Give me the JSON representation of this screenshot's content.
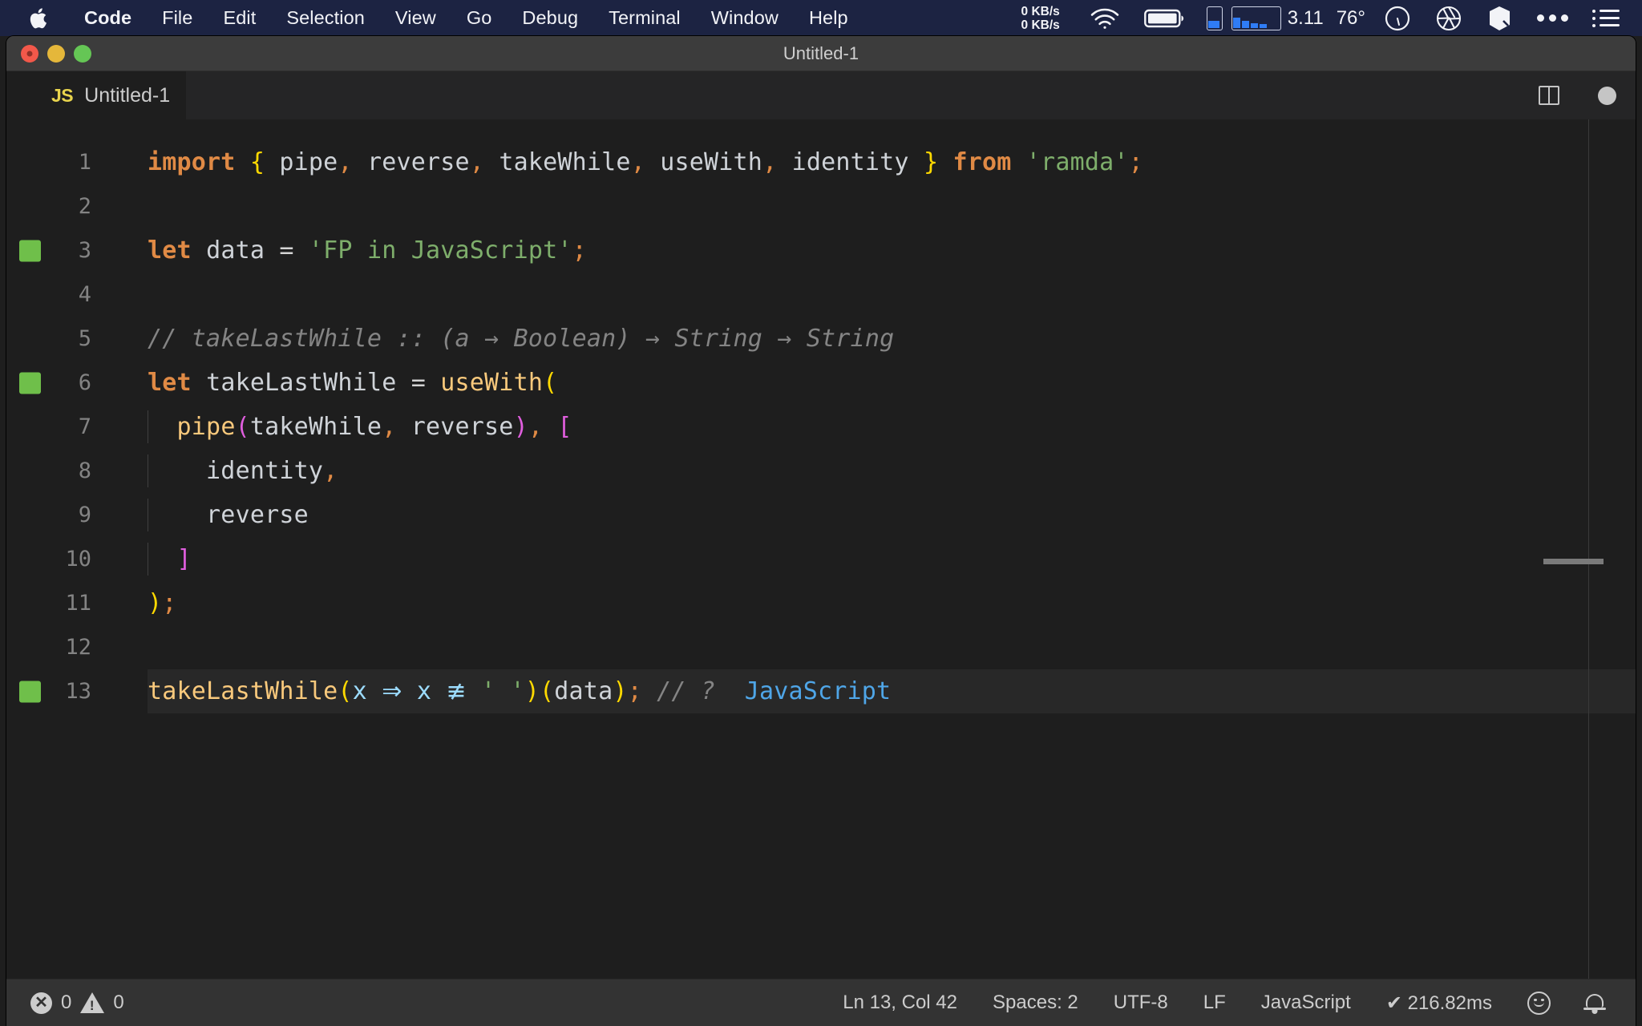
{
  "menubar": {
    "apple_icon": "apple-logo-icon",
    "items": [
      {
        "label": "Code",
        "bold": true
      },
      {
        "label": "File",
        "bold": false
      },
      {
        "label": "Edit",
        "bold": false
      },
      {
        "label": "Selection",
        "bold": false
      },
      {
        "label": "View",
        "bold": false
      },
      {
        "label": "Go",
        "bold": false
      },
      {
        "label": "Debug",
        "bold": false
      },
      {
        "label": "Terminal",
        "bold": false
      },
      {
        "label": "Window",
        "bold": false
      },
      {
        "label": "Help",
        "bold": false
      }
    ],
    "network_up": "0 KB/s",
    "network_down": "0 KB/s",
    "wifi_icon": "wifi-icon",
    "battery_icon": "battery-icon",
    "cpu_meter_icon": "cpu-meter-icon",
    "activity_graph_icon": "activity-graph-icon",
    "load_value": "3.11",
    "temperature": "76°",
    "gauge_icon": "gauge-icon",
    "aperture_icon": "aperture-icon",
    "cube_icon": "cube-icon",
    "overflow_icon": "ellipsis-icon",
    "control_center_icon": "list-menu-icon",
    "bg_color": "#1c2342"
  },
  "window": {
    "title": "Untitled-1",
    "traffic_lights": [
      "close",
      "minimize",
      "zoom"
    ]
  },
  "tabbar": {
    "tab": {
      "badge": "JS",
      "label": "Untitled-1"
    },
    "split_editor_icon": "split-editor-icon",
    "unsaved_indicator": "dirty-dot-icon"
  },
  "editor": {
    "language": "JavaScript",
    "lines": [
      {
        "num": "1",
        "marker": false,
        "current": false,
        "indent_guides": 0
      },
      {
        "num": "2",
        "marker": false,
        "current": false,
        "indent_guides": 0
      },
      {
        "num": "3",
        "marker": true,
        "current": false,
        "indent_guides": 0
      },
      {
        "num": "4",
        "marker": false,
        "current": false,
        "indent_guides": 0
      },
      {
        "num": "5",
        "marker": false,
        "current": false,
        "indent_guides": 0
      },
      {
        "num": "6",
        "marker": true,
        "current": false,
        "indent_guides": 0
      },
      {
        "num": "7",
        "marker": false,
        "current": false,
        "indent_guides": 0
      },
      {
        "num": "8",
        "marker": false,
        "current": false,
        "indent_guides": 1
      },
      {
        "num": "9",
        "marker": false,
        "current": false,
        "indent_guides": 1
      },
      {
        "num": "10",
        "marker": false,
        "current": false,
        "indent_guides": 1
      },
      {
        "num": "11",
        "marker": false,
        "current": false,
        "indent_guides": 0
      },
      {
        "num": "12",
        "marker": false,
        "current": false,
        "indent_guides": 0
      },
      {
        "num": "13",
        "marker": true,
        "current": true,
        "indent_guides": 0
      }
    ],
    "source_text": [
      "import { pipe, reverse, takeWhile, useWith, identity } from 'ramda';",
      "",
      "let data = 'FP in JavaScript';",
      "",
      "// takeLastWhile :: (a → Boolean) → String → String",
      "let takeLastWhile = useWith(",
      "  pipe(takeWhile, reverse), [",
      "    identity,",
      "    reverse",
      "  ]",
      ");",
      "",
      "takeLastWhile(x ⇒ x ≢ ' ')(data); // ?  JavaScript"
    ],
    "inline_result": "JavaScript",
    "colors": {
      "background": "#1e1e1e",
      "keyword": "#e08a45",
      "string": "#7eae6b",
      "function": "#f9c97c",
      "comment": "#848484",
      "bracket_yellow": "#ffd900",
      "bracket_magenta": "#e05ede",
      "variable": "#9cdcfe",
      "result_blue": "#4fa6e8",
      "gutter_marker": "#6fbf4a"
    }
  },
  "statusbar": {
    "error_icon": "error-circle-icon",
    "error_count": "0",
    "warning_icon": "warning-triangle-icon",
    "warning_count": "0",
    "cursor_position": "Ln 13, Col 42",
    "indentation": "Spaces: 2",
    "encoding": "UTF-8",
    "eol": "LF",
    "language_mode": "JavaScript",
    "run_status": "✔ 216.82ms",
    "feedback_icon": "smiley-icon",
    "notifications_icon": "bell-icon"
  }
}
